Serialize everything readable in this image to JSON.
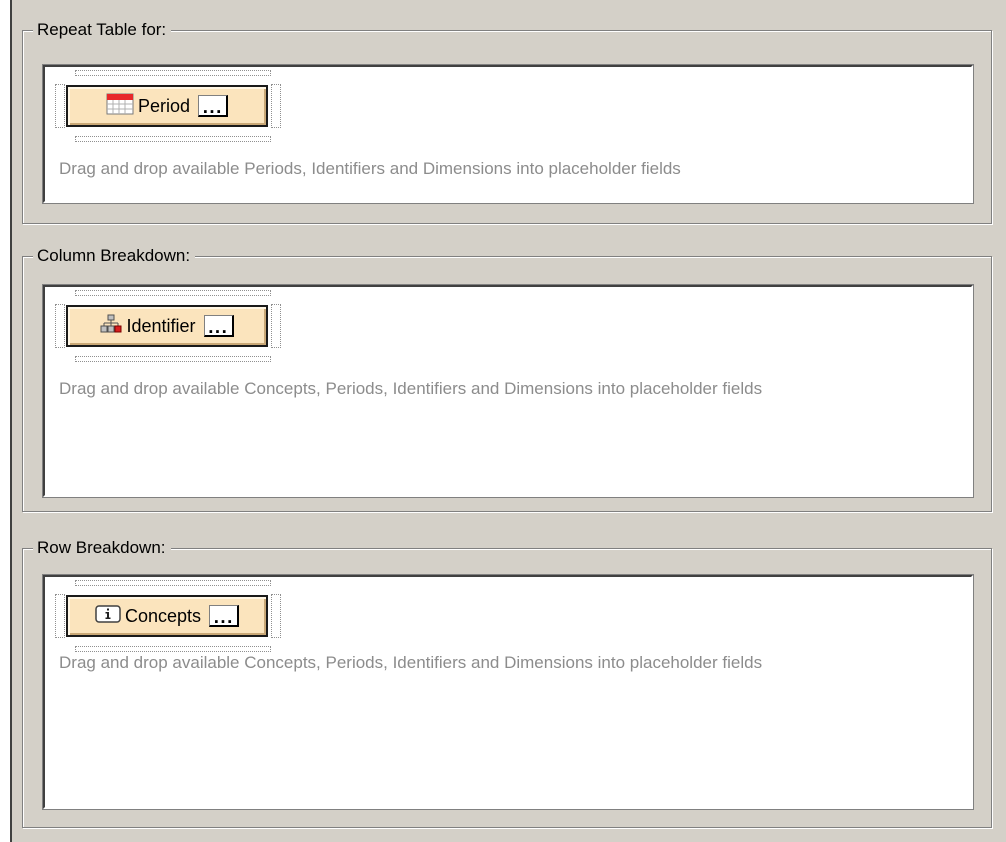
{
  "sections": [
    {
      "legend": "Repeat Table for:",
      "placeholder": {
        "label": "Period",
        "icon": "calendar-icon",
        "more": "..."
      },
      "hint": "Drag and drop available Periods, Identifiers and Dimensions into placeholder fields"
    },
    {
      "legend": "Column Breakdown:",
      "placeholder": {
        "label": "Identifier",
        "icon": "hierarchy-icon",
        "more": "..."
      },
      "hint": "Drag and drop available Concepts, Periods, Identifiers and Dimensions into placeholder fields"
    },
    {
      "legend": "Row Breakdown:",
      "placeholder": {
        "label": "Concepts",
        "icon": "info-icon",
        "more": "..."
      },
      "hint": "Drag and drop available Concepts, Periods, Identifiers and Dimensions into placeholder fields"
    }
  ],
  "colors": {
    "dialog_bg": "#d4d0c8",
    "placeholder_bg": "#fbe4bd",
    "hint_text": "#8c8c8c",
    "calendar_accent": "#e8282a",
    "hierarchy_node_highlight": "#d81e1e"
  }
}
